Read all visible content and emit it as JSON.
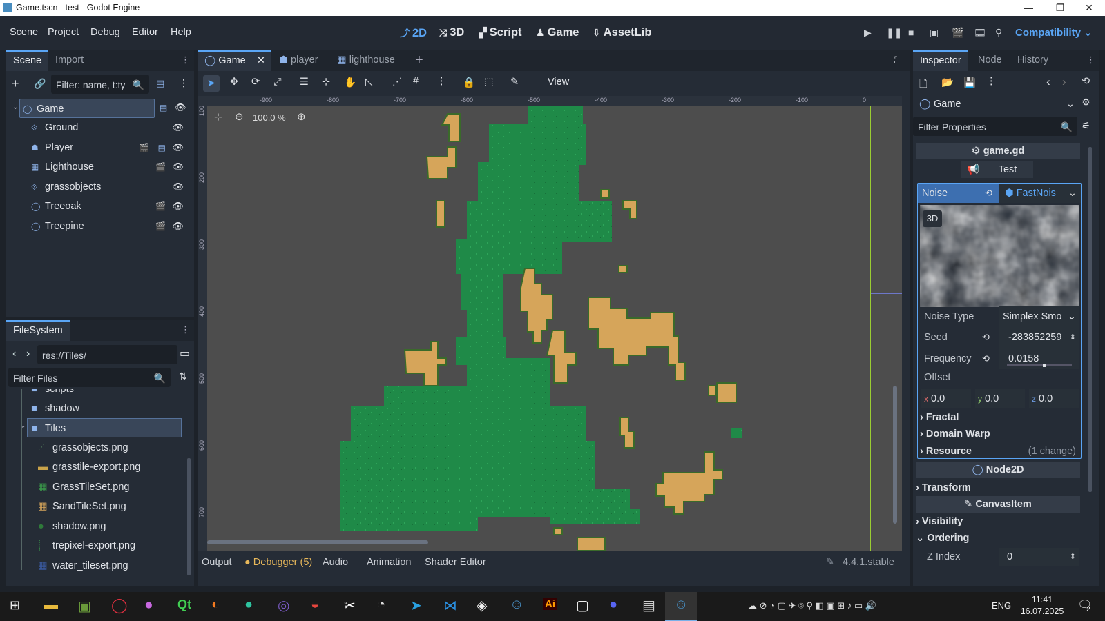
{
  "window": {
    "title": "Game.tscn - test - Godot Engine"
  },
  "menu": [
    "Scene",
    "Project",
    "Debug",
    "Editor",
    "Help"
  ],
  "workspaces": [
    {
      "label": "2D",
      "icon": "2d-icon",
      "active": true
    },
    {
      "label": "3D",
      "icon": "3d-icon"
    },
    {
      "label": "Script",
      "icon": "script-icon"
    },
    {
      "label": "Game",
      "icon": "game-icon"
    },
    {
      "label": "AssetLib",
      "icon": "assetlib-icon"
    }
  ],
  "renderer": "Compatibility",
  "scene_dock": {
    "tabs": [
      "Scene",
      "Import"
    ],
    "filter_placeholder": "Filter: name, t:ty",
    "nodes": [
      {
        "name": "Game",
        "icon": "node2d-icon",
        "selected": true,
        "script": true
      },
      {
        "name": "Ground",
        "icon": "tilemap-icon"
      },
      {
        "name": "Player",
        "icon": "character-icon",
        "scene": true,
        "script": true
      },
      {
        "name": "Lighthouse",
        "icon": "sprite-icon",
        "scene": true
      },
      {
        "name": "grassobjects",
        "icon": "tilemap-icon"
      },
      {
        "name": "Treeoak",
        "icon": "node2d-icon",
        "scene": true
      },
      {
        "name": "Treepine",
        "icon": "node2d-icon",
        "scene": true
      }
    ]
  },
  "filesystem": {
    "title": "FileSystem",
    "path": "res://Tiles/",
    "filter_placeholder": "Filter Files",
    "items": [
      {
        "name": "scripts",
        "type": "folder"
      },
      {
        "name": "shadow",
        "type": "folder"
      },
      {
        "name": "Tiles",
        "type": "folder",
        "selected": true
      },
      {
        "name": "grassobjects.png",
        "type": "file"
      },
      {
        "name": "grasstile-export.png",
        "type": "file"
      },
      {
        "name": "GrassTileSet.png",
        "type": "file"
      },
      {
        "name": "SandTileSet.png",
        "type": "file"
      },
      {
        "name": "shadow.png",
        "type": "file"
      },
      {
        "name": "trepixel-export.png",
        "type": "file"
      },
      {
        "name": "water_tileset.png",
        "type": "file"
      }
    ]
  },
  "editor_tabs": [
    "Game",
    "player",
    "lighthouse"
  ],
  "toolbar": {
    "view_label": "View"
  },
  "zoom": "100.0 %",
  "ruler_h": [
    "-900",
    "-800",
    "-700",
    "-600",
    "-500",
    "-400",
    "-300",
    "-200",
    "-100",
    "0"
  ],
  "ruler_v": [
    "100",
    "200",
    "300",
    "400",
    "500",
    "600",
    "700"
  ],
  "bottom_tabs": [
    "Output",
    "Debugger (5)",
    "Audio",
    "Animation",
    "Shader Editor"
  ],
  "version": "4.4.1.stable",
  "inspector": {
    "tabs": [
      "Inspector",
      "Node",
      "History"
    ],
    "object": "Game",
    "filter_placeholder": "Filter Properties",
    "script": "game.gd",
    "category": "Test",
    "noise_label": "Noise",
    "noise_value": "FastNois",
    "preview_badge": "3D",
    "noise_type_label": "Noise Type",
    "noise_type_value": "Simplex Smo",
    "seed_label": "Seed",
    "seed_value": "-283852259",
    "frequency_label": "Frequency",
    "frequency_value": "0.0158",
    "offset_label": "Offset",
    "offset_x": "0.0",
    "offset_y": "0.0",
    "offset_z": "0.0",
    "axis_x": "x",
    "axis_y": "y",
    "axis_z": "z",
    "sections": [
      "Fractal",
      "Domain Warp",
      "Resource"
    ],
    "resource_change": "(1 change)",
    "node2d": "Node2D",
    "transform": "Transform",
    "canvasitem": "CanvasItem",
    "visibility": "Visibility",
    "ordering": "Ordering",
    "zindex_label": "Z Index",
    "zindex_value": "0"
  },
  "taskbar": {
    "lang": "ENG",
    "time": "11:41",
    "date": "16.07.2025",
    "notifications": "2"
  },
  "colors": {
    "accent": "#5aa5f5",
    "grass": "#1f8a48",
    "sand": "#d6a55a",
    "canvas_bg": "#4d4d4d"
  }
}
